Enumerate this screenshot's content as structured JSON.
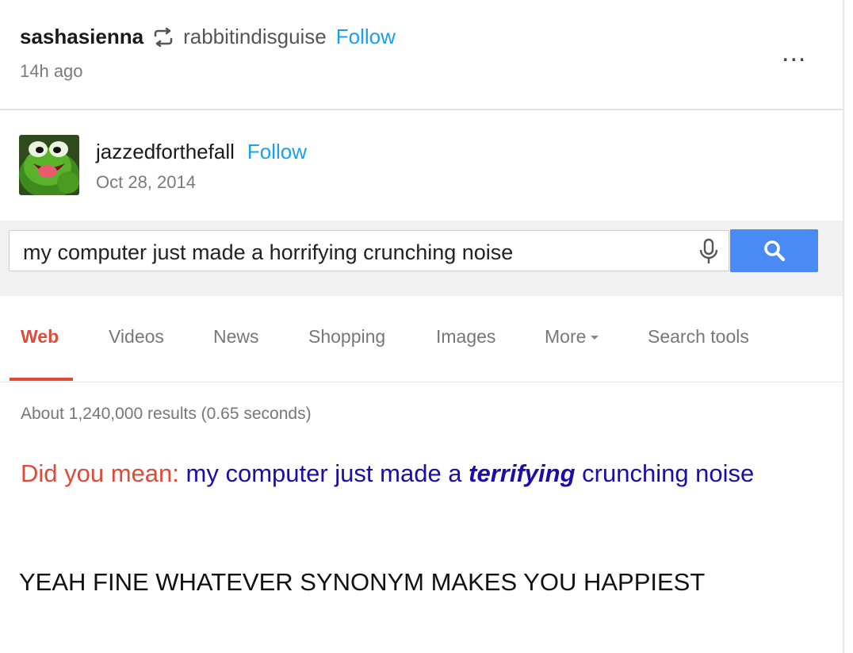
{
  "reblog": {
    "username": "sashasienna",
    "reblog_icon": "reblog-icon",
    "from_user": "rabbitindisguise",
    "follow_label": "Follow",
    "timestamp": "14h ago",
    "more_label": "..."
  },
  "original_post": {
    "avatar": "kermit-avatar",
    "username": "jazzedforthefall",
    "follow_label": "Follow",
    "date": "Oct 28, 2014"
  },
  "google": {
    "query": "my computer just made a horrifying crunching noise",
    "mic_icon": "microphone-icon",
    "search_icon": "search-icon",
    "tabs": [
      {
        "label": "Web",
        "active": true
      },
      {
        "label": "Videos"
      },
      {
        "label": "News"
      },
      {
        "label": "Shopping"
      },
      {
        "label": "Images"
      },
      {
        "label": "More"
      },
      {
        "label": "Search tools"
      }
    ],
    "stats": "About 1,240,000 results (0.65 seconds)",
    "dym_label": "Did you mean:",
    "dym_before": "my computer just made a",
    "dym_emphasis": "terrifying",
    "dym_after": "crunching noise"
  },
  "caption": "YEAH FINE WHATEVER SYNONYM MAKES YOU HAPPIEST",
  "colors": {
    "tumblr_follow": "#1ea0e6",
    "google_red": "#dd4b39",
    "google_blue_btn": "#4a8af4",
    "link_blue": "#1a0dab"
  }
}
